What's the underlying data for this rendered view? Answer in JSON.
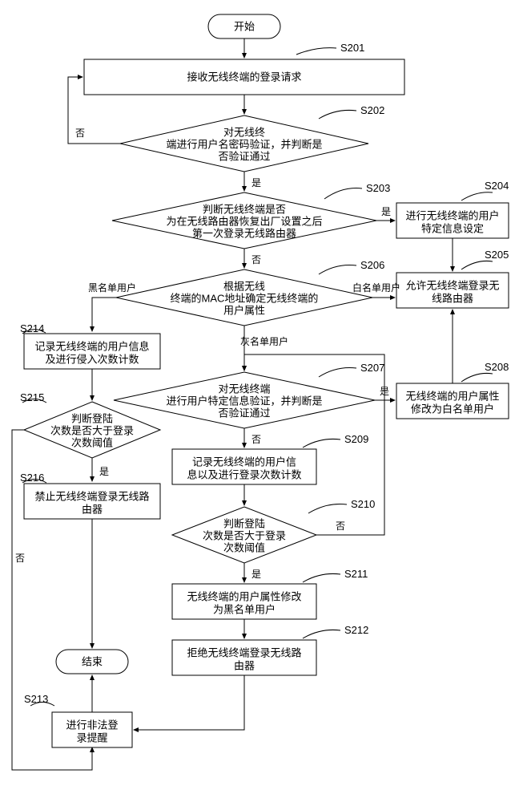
{
  "terminals": {
    "start": "开始",
    "end": "结束"
  },
  "steps": {
    "s201": {
      "label": "S201",
      "text": [
        "接收无线终端的登录请求"
      ]
    },
    "s202": {
      "label": "S202",
      "text": [
        "对无线终",
        "端进行用户名密码验证，并判断是",
        "否验证通过"
      ]
    },
    "s203": {
      "label": "S203",
      "text": [
        "判断无线终端是否",
        "为在无线路由器恢复出厂设置之后",
        "第一次登录无线路由器"
      ]
    },
    "s204": {
      "label": "S204",
      "text": [
        "进行无线终端的用户",
        "特定信息设定"
      ]
    },
    "s205": {
      "label": "S205",
      "text": [
        "允许无线终端登录无",
        "线路由器"
      ]
    },
    "s206": {
      "label": "S206",
      "text": [
        "根据无线",
        "终端的MAC地址确定无线终端的",
        "用户属性"
      ]
    },
    "s207": {
      "label": "S207",
      "text": [
        "对无线终端",
        "进行用户特定信息验证，并判断是",
        "否验证通过"
      ]
    },
    "s208": {
      "label": "S208",
      "text": [
        "无线终端的用户属性",
        "修改为白名单用户"
      ]
    },
    "s209": {
      "label": "S209",
      "text": [
        "记录无线终端的用户信",
        "息以及进行登录次数计数"
      ]
    },
    "s210": {
      "label": "S210",
      "text": [
        "判断登陆",
        "次数是否大于登录",
        "次数阈值"
      ]
    },
    "s211": {
      "label": "S211",
      "text": [
        "无线终端的用户属性修改",
        "为黑名单用户"
      ]
    },
    "s212": {
      "label": "S212",
      "text": [
        "拒绝无线终端登录无线路",
        "由器"
      ]
    },
    "s213": {
      "label": "S213",
      "text": [
        "进行非法登",
        "录提醒"
      ]
    },
    "s214": {
      "label": "S214",
      "text": [
        "记录无线终端的用户信息",
        "及进行侵入次数计数"
      ]
    },
    "s215": {
      "label": "S215",
      "text": [
        "判断登陆",
        "次数是否大于登录",
        "次数阈值"
      ]
    },
    "s216": {
      "label": "S216",
      "text": [
        "禁止无线终端登录无线路",
        "由器"
      ]
    }
  },
  "edges": {
    "yes": "是",
    "no": "否",
    "blacklist": "黑名单用户",
    "whitelist": "白名单用户",
    "graylist": "灰名单用户"
  }
}
